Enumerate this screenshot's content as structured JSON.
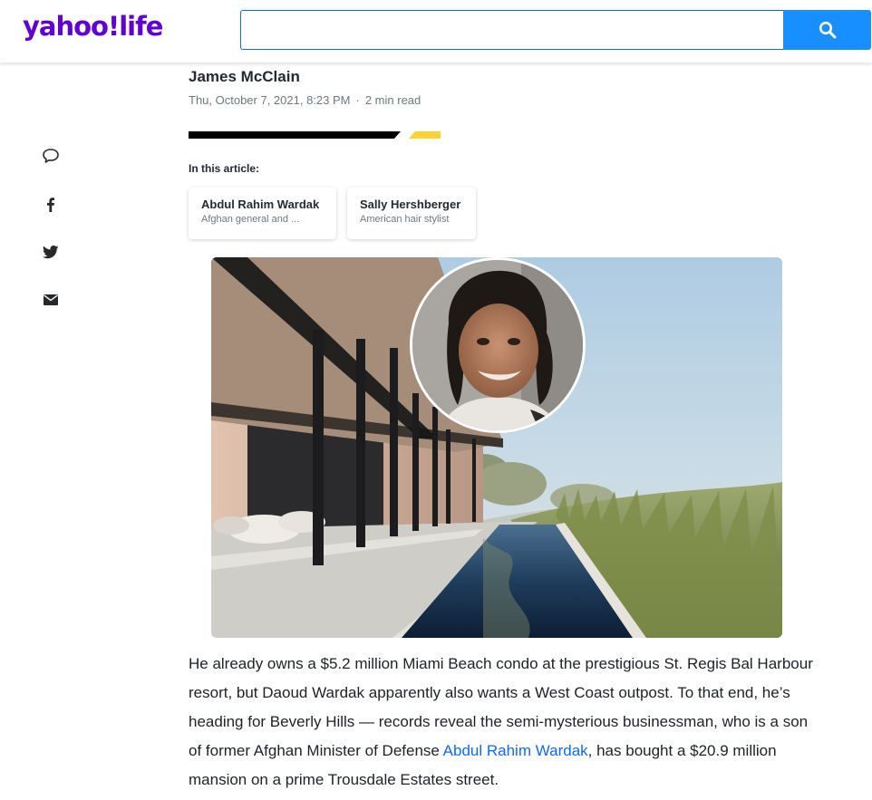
{
  "header": {
    "logo_text": "yahoo!life",
    "search": {
      "value": "",
      "placeholder": ""
    },
    "search_button_icon": "search-icon",
    "brand_color": "#6001d2",
    "accent_color": "#188fff"
  },
  "share_rail": {
    "items": [
      {
        "icon": "comment-icon"
      },
      {
        "icon": "facebook-icon"
      },
      {
        "icon": "twitter-icon"
      },
      {
        "icon": "mail-icon"
      }
    ]
  },
  "article": {
    "author": "James McClain",
    "date": "Thu, October 7, 2021, 8:23 PM",
    "separator": "·",
    "read_time": "2 min read",
    "in_this_article_label": "In this article:",
    "entities": [
      {
        "name": "Abdul Rahim Wardak",
        "description": "Afghan general and ..."
      },
      {
        "name": "Sally Hershberger",
        "description": "American hair stylist"
      }
    ],
    "body": {
      "text_before_link": "He already owns a $5.2 million Miami Beach condo at the prestigious St. Regis Bal Harbour resort, but Daoud Wardak apparently also wants a West Coast outpost. To that end, he’s heading for Beverly Hills — records reveal the semi-mysterious businessman, who is a son of former Afghan Minister of Defense ",
      "link_text": "Abdul Rahim Wardak",
      "text_after_link": ", has bought a $20.9 million mansion on a prime Trousdale Estates street."
    }
  }
}
